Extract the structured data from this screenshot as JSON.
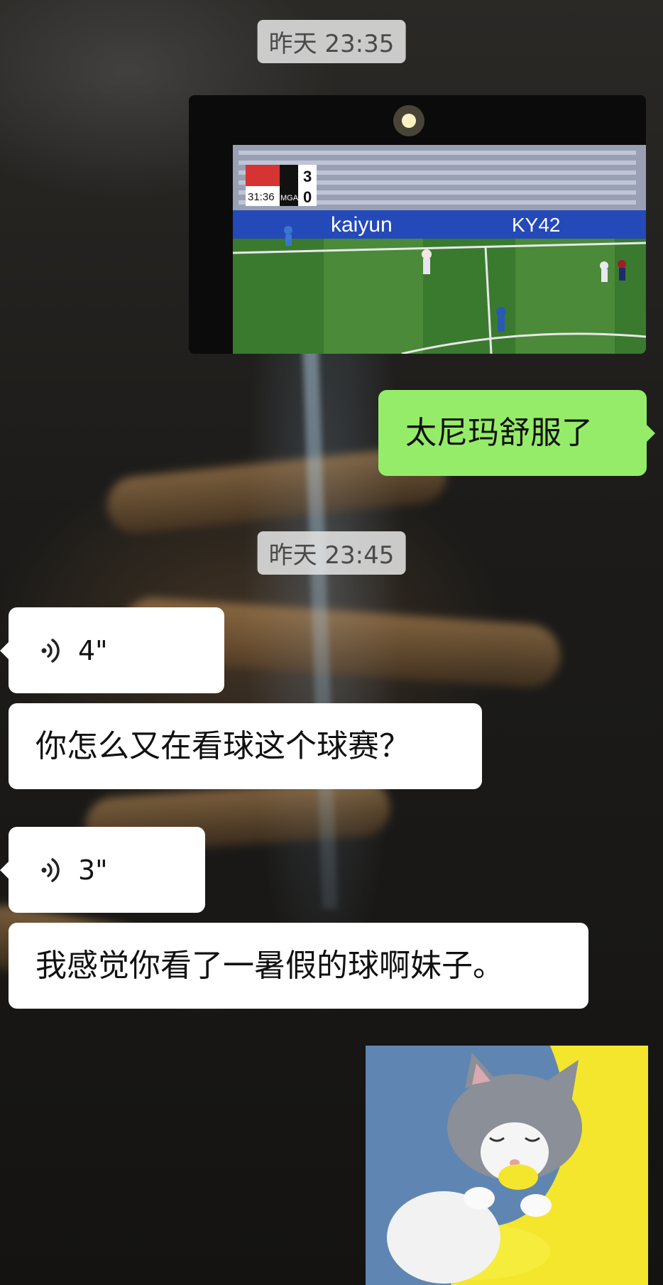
{
  "messages": {
    "ts_1": "昨天 23:35",
    "photo_desc": "football-match-photo",
    "sent_text": "太尼玛舒服了",
    "ts_2": "昨天 23:45",
    "voice_1_duration": "4\"",
    "text_1": "你怎么又在看球这个球赛？",
    "voice_2_duration": "3\"",
    "text_2": "我感觉你看了一暑假的球啊妹子。",
    "sticker_desc": "cat-hugging-plush-sticker"
  },
  "photo": {
    "score_home": "3",
    "score_away": "0",
    "match_clock": "31:36",
    "team_code": "MGA",
    "ad_brand": "kaiyun",
    "ad_code": "KY42"
  },
  "colors": {
    "incoming_bubble": "#ffffff",
    "outgoing_bubble": "#95ec69",
    "timestamp_bg": "#e1e1e1"
  },
  "icons": {
    "voice": "voice-wave-icon"
  }
}
